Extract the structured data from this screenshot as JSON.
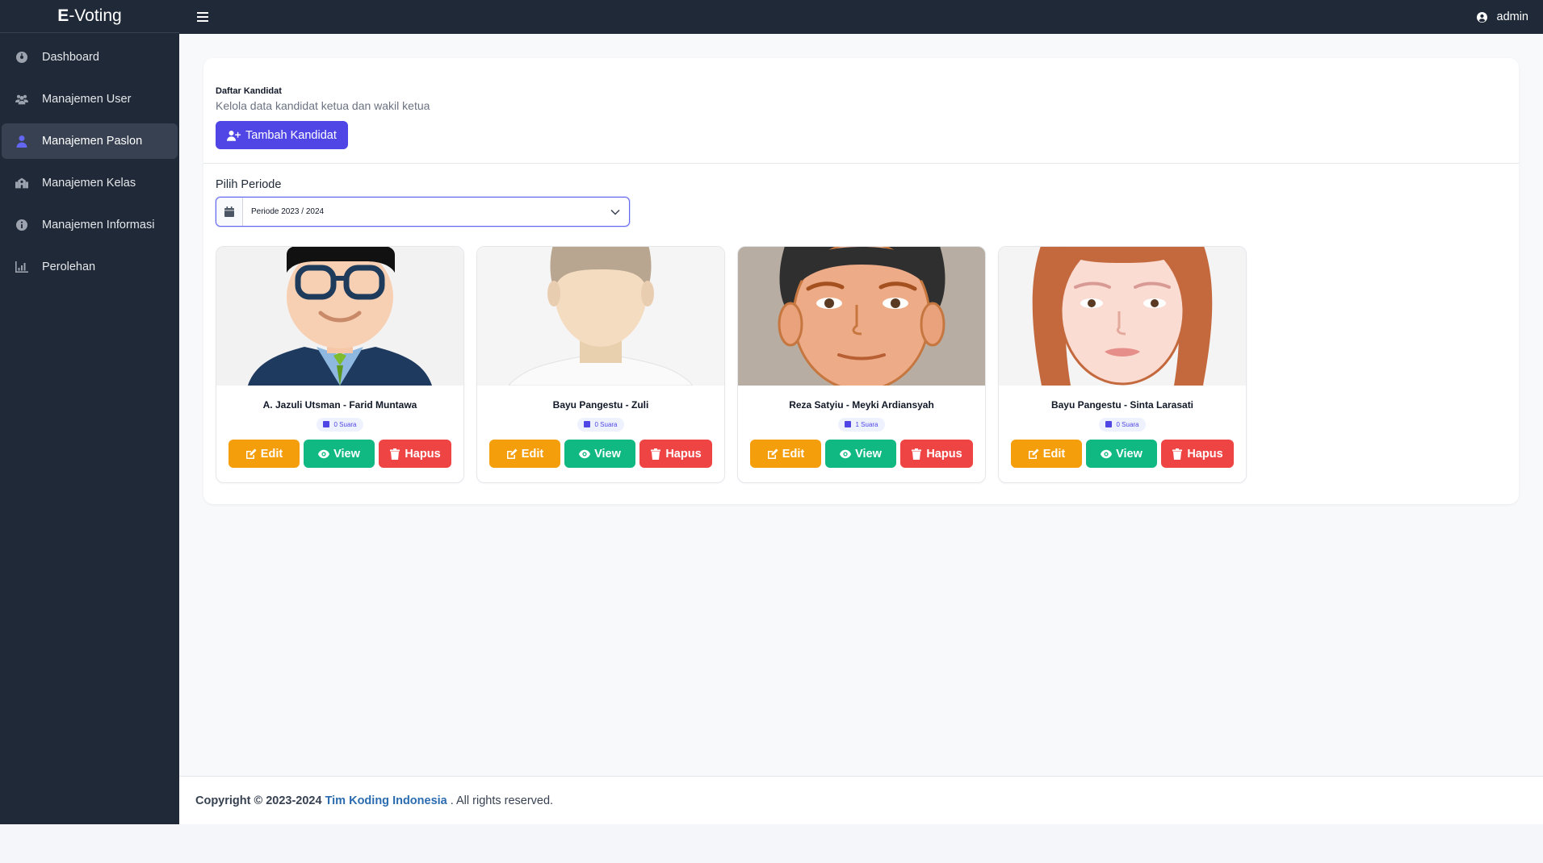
{
  "brand": {
    "bold": "E",
    "rest": "-Voting"
  },
  "sidebar": {
    "items": [
      {
        "label": "Dashboard",
        "icon": "dashboard-icon",
        "active": false
      },
      {
        "label": "Manajemen User",
        "icon": "users-icon",
        "active": false
      },
      {
        "label": "Manajemen Paslon",
        "icon": "user-icon",
        "active": true
      },
      {
        "label": "Manajemen Kelas",
        "icon": "school-icon",
        "active": false
      },
      {
        "label": "Manajemen Informasi",
        "icon": "info-icon",
        "active": false
      },
      {
        "label": "Perolehan",
        "icon": "chart-icon",
        "active": false
      }
    ]
  },
  "topbar": {
    "user": "admin"
  },
  "main": {
    "title": "Daftar Kandidat",
    "subtitle": "Kelola data kandidat ketua dan wakil ketua",
    "add_button": "Tambah Kandidat",
    "periode_label": "Pilih Periode",
    "periode_value": "Periode 2023 / 2024",
    "candidates": [
      {
        "name": "A. Jazuli Utsman - Farid Muntawa",
        "votes": "0 Suara"
      },
      {
        "name": "Bayu Pangestu - Zuli",
        "votes": "0 Suara"
      },
      {
        "name": "Reza Satyiu - Meyki Ardiansyah",
        "votes": "1 Suara"
      },
      {
        "name": "Bayu Pangestu - Sinta Larasati",
        "votes": "0 Suara"
      }
    ],
    "buttons": {
      "edit": "Edit",
      "view": "View",
      "delete": "Hapus"
    }
  },
  "footer": {
    "copyright": "Copyright © 2023-2024",
    "link": "Tim Koding Indonesia",
    "rest": ". All rights reserved."
  },
  "colors": {
    "sidebar": "#1f2937",
    "primary": "#4f46e5",
    "edit": "#f59e0b",
    "view": "#10b981",
    "delete": "#ef4444"
  }
}
